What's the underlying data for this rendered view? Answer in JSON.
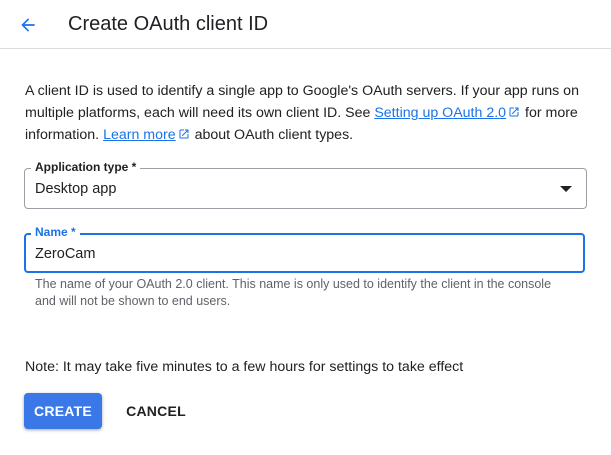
{
  "header": {
    "title": "Create OAuth client ID",
    "back_icon": "arrow-back-icon"
  },
  "intro": {
    "text_1": "A client ID is used to identify a single app to Google's OAuth servers. If your app runs on multiple platforms, each will need its own client ID. See ",
    "link_1": "Setting up OAuth 2.0",
    "text_2": " for more information. ",
    "link_2": "Learn more",
    "text_3": " about OAuth client types."
  },
  "application_type": {
    "label": "Application type *",
    "value": "Desktop app"
  },
  "name_field": {
    "label": "Name *",
    "value": "ZeroCam",
    "hint": "The name of your OAuth 2.0 client. This name is only used to identify the client in the console and will not be shown to end users."
  },
  "note": "Note: It may take five minutes to a few hours for settings to take effect",
  "buttons": {
    "create": "CREATE",
    "cancel": "CANCEL"
  },
  "colors": {
    "accent": "#1a73e8",
    "primary_button": "#3b78e7",
    "text": "#202124",
    "hint_text": "#5f6368",
    "border": "#dadce0"
  }
}
